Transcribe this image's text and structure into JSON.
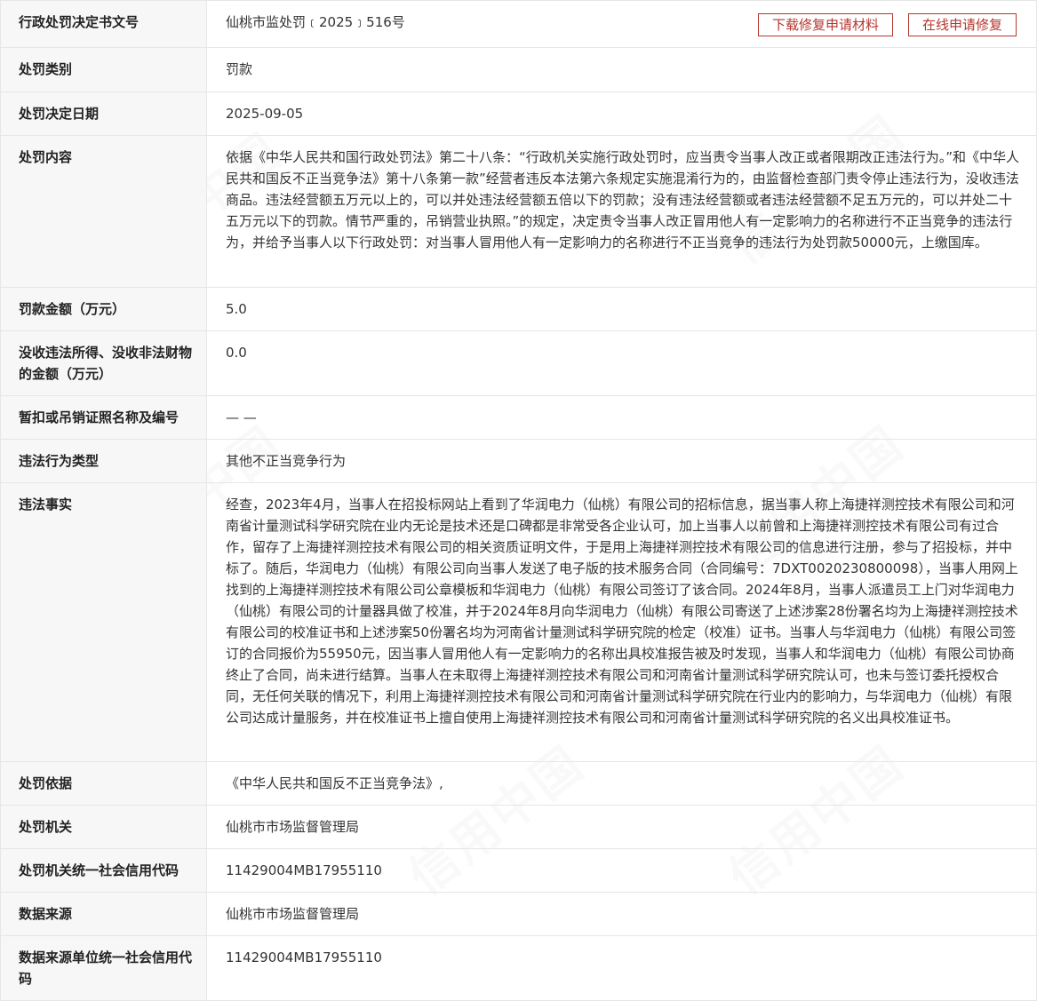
{
  "watermark": "信用中国",
  "actions": {
    "download_label": "下载修复申请材料",
    "online_label": "在线申请修复"
  },
  "rows": [
    {
      "label": "行政处罚决定书文号",
      "value": "仙桃市监处罚﹝2025﹞516号"
    },
    {
      "label": "处罚类别",
      "value": "罚款"
    },
    {
      "label": "处罚决定日期",
      "value": "2025-09-05"
    },
    {
      "label": "处罚内容",
      "value": "依据《中华人民共和国行政处罚法》第二十八条：“行政机关实施行政处罚时，应当责令当事人改正或者限期改正违法行为。”和《中华人民共和国反不正当竞争法》第十八条第一款”经营者违反本法第六条规定实施混淆行为的，由监督检查部门责令停止违法行为，没收违法商品。违法经营额五万元以上的，可以并处违法经营额五倍以下的罚款；没有违法经营额或者违法经营额不足五万元的，可以并处二十五万元以下的罚款。情节严重的，吊销营业执照。”的规定，决定责令当事人改正冒用他人有一定影响力的名称进行不正当竞争的违法行为，并给予当事人以下行政处罚：对当事人冒用他人有一定影响力的名称进行不正当竞争的违法行为处罚款50000元，上缴国库。"
    },
    {
      "label": "罚款金额（万元）",
      "value": "5.0"
    },
    {
      "label": "没收违法所得、没收非法财物的金额（万元）",
      "value": "0.0"
    },
    {
      "label": "暂扣或吊销证照名称及编号",
      "value": "— —"
    },
    {
      "label": "违法行为类型",
      "value": "其他不正当竞争行为"
    },
    {
      "label": "违法事实",
      "value": "经查，2023年4月，当事人在招投标网站上看到了华润电力（仙桃）有限公司的招标信息，据当事人称上海捷祥测控技术有限公司和河南省计量测试科学研究院在业内无论是技术还是口碑都是非常受各企业认可，加上当事人以前曾和上海捷祥测控技术有限公司有过合作，留存了上海捷祥测控技术有限公司的相关资质证明文件，于是用上海捷祥测控技术有限公司的信息进行注册，参与了招投标，并中标了。随后，华润电力（仙桃）有限公司向当事人发送了电子版的技术服务合同（合同编号：7DXT0020230800098），当事人用网上找到的上海捷祥测控技术有限公司公章模板和华润电力（仙桃）有限公司签订了该合同。2024年8月，当事人派遣员工上门对华润电力（仙桃）有限公司的计量器具做了校准，并于2024年8月向华润电力（仙桃）有限公司寄送了上述涉案28份署名均为上海捷祥测控技术有限公司的校准证书和上述涉案50份署名均为河南省计量测试科学研究院的检定（校准）证书。当事人与华润电力（仙桃）有限公司签订的合同报价为55950元，因当事人冒用他人有一定影响力的名称出具校准报告被及时发现，当事人和华润电力（仙桃）有限公司协商终止了合同，尚未进行结算。当事人在未取得上海捷祥测控技术有限公司和河南省计量测试科学研究院认可，也未与签订委托授权合同，无任何关联的情况下，利用上海捷祥测控技术有限公司和河南省计量测试科学研究院在行业内的影响力，与华润电力（仙桃）有限公司达成计量服务，并在校准证书上擅自使用上海捷祥测控技术有限公司和河南省计量测试科学研究院的名义出具校准证书。"
    },
    {
      "label": "处罚依据",
      "value": "《中华人民共和国反不正当竞争法》,"
    },
    {
      "label": "处罚机关",
      "value": "仙桃市市场监督管理局"
    },
    {
      "label": "处罚机关统一社会信用代码",
      "value": "11429004MB17955110"
    },
    {
      "label": "数据来源",
      "value": "仙桃市市场监督管理局"
    },
    {
      "label": "数据来源单位统一社会信用代码",
      "value": "11429004MB17955110"
    }
  ]
}
